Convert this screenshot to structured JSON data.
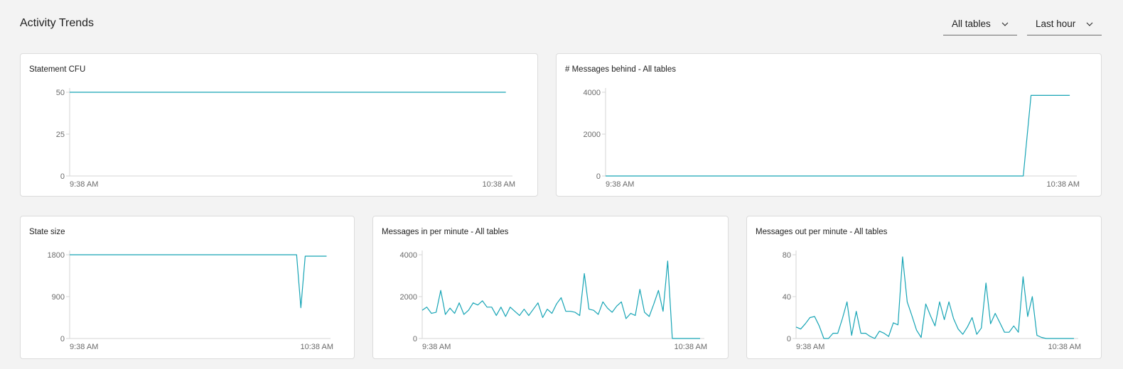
{
  "header": {
    "title": "Activity Trends",
    "filter_tables": "All tables",
    "filter_range": "Last hour"
  },
  "colors": {
    "line": "#16a4b5",
    "axis": "#d6d6d6",
    "tick_text": "#6b6b6b"
  },
  "cards": [
    {
      "id": "statement-cfu",
      "title": "Statement CFU"
    },
    {
      "id": "messages-behind",
      "title": "# Messages behind - All tables"
    },
    {
      "id": "state-size",
      "title": "State size"
    },
    {
      "id": "messages-in",
      "title": "Messages in per minute - All tables"
    },
    {
      "id": "messages-out",
      "title": "Messages out per minute - All tables"
    }
  ],
  "chart_data": [
    {
      "type": "line",
      "title": "Statement CFU",
      "x_tick_labels": [
        "9:38 AM",
        "10:38 AM"
      ],
      "y_ticks": [
        0,
        25,
        50
      ],
      "ylim": [
        0,
        50
      ],
      "series": [
        {
          "values": [
            50,
            50,
            50,
            50,
            50,
            50,
            50,
            50,
            50,
            50,
            50,
            50,
            50,
            50,
            50,
            50,
            50,
            50,
            50,
            50,
            50,
            50,
            50,
            50,
            50,
            50,
            50,
            50,
            50,
            50,
            50,
            50,
            50,
            50,
            50,
            50,
            50,
            50,
            50,
            50,
            50,
            50,
            50,
            50,
            50,
            50,
            50,
            50,
            50,
            50,
            50,
            50,
            50,
            50,
            50,
            50,
            50,
            50,
            50,
            50
          ]
        }
      ],
      "x_count": 61
    },
    {
      "type": "line",
      "title": "# Messages behind - All tables",
      "x_tick_labels": [
        "9:38 AM",
        "10:38 AM"
      ],
      "y_ticks": [
        0,
        2000,
        4000
      ],
      "ylim": [
        0,
        4000
      ],
      "series": [
        {
          "values": [
            0,
            0,
            0,
            0,
            0,
            0,
            0,
            0,
            0,
            0,
            0,
            0,
            0,
            0,
            0,
            0,
            0,
            0,
            0,
            0,
            0,
            0,
            0,
            0,
            0,
            0,
            0,
            0,
            0,
            0,
            0,
            0,
            0,
            0,
            0,
            0,
            0,
            0,
            0,
            0,
            0,
            0,
            0,
            0,
            0,
            0,
            0,
            0,
            0,
            0,
            0,
            0,
            0,
            0,
            0,
            3850,
            3850,
            3850,
            3850,
            3850,
            3850
          ]
        }
      ],
      "x_count": 61
    },
    {
      "type": "line",
      "title": "State size",
      "x_tick_labels": [
        "9:38 AM",
        "10:38 AM"
      ],
      "y_ticks": [
        0,
        900,
        1800
      ],
      "ylim": [
        0,
        1800
      ],
      "series": [
        {
          "values": [
            1800,
            1800,
            1800,
            1800,
            1800,
            1800,
            1800,
            1800,
            1800,
            1800,
            1800,
            1800,
            1800,
            1800,
            1800,
            1800,
            1800,
            1800,
            1800,
            1800,
            1800,
            1800,
            1800,
            1800,
            1800,
            1800,
            1800,
            1800,
            1800,
            1800,
            1800,
            1800,
            1800,
            1800,
            1800,
            1800,
            1800,
            1800,
            1800,
            1800,
            1800,
            1800,
            1800,
            1800,
            1800,
            1800,
            1800,
            1800,
            1800,
            1800,
            1800,
            1800,
            1800,
            1800,
            660,
            1770,
            1770,
            1770,
            1770,
            1770,
            1770
          ]
        }
      ],
      "x_count": 61
    },
    {
      "type": "line",
      "title": "Messages in per minute - All tables",
      "x_tick_labels": [
        "9:38 AM",
        "10:38 AM"
      ],
      "y_ticks": [
        0,
        2000,
        4000
      ],
      "ylim": [
        0,
        4000
      ],
      "series": [
        {
          "values": [
            1350,
            1500,
            1200,
            1250,
            2300,
            1150,
            1450,
            1200,
            1700,
            1150,
            1350,
            1700,
            1600,
            1800,
            1500,
            1500,
            1100,
            1500,
            1050,
            1500,
            1300,
            1100,
            1400,
            1100,
            1400,
            1700,
            1000,
            1400,
            1200,
            1650,
            1950,
            1300,
            1300,
            1250,
            1100,
            3100,
            1400,
            1350,
            1150,
            1750,
            1450,
            1250,
            1550,
            1750,
            950,
            1200,
            1100,
            2350,
            1250,
            1050,
            1650,
            2300,
            1300,
            3700,
            0,
            0,
            0,
            0,
            0,
            0,
            0
          ]
        }
      ],
      "x_count": 61
    },
    {
      "type": "line",
      "title": "Messages out per minute - All tables",
      "x_tick_labels": [
        "9:38 AM",
        "10:38 AM"
      ],
      "y_ticks": [
        0,
        40,
        80
      ],
      "ylim": [
        0,
        80
      ],
      "series": [
        {
          "values": [
            11,
            9,
            14,
            20,
            21,
            12,
            0,
            0,
            5,
            5,
            19,
            35,
            3,
            26,
            5,
            5,
            2,
            0,
            7,
            5,
            2,
            15,
            13,
            78,
            35,
            22,
            8,
            1,
            33,
            22,
            12,
            35,
            18,
            35,
            19,
            9,
            4,
            11,
            20,
            4,
            10,
            53,
            14,
            24,
            15,
            6,
            6,
            12,
            6,
            59,
            21,
            40,
            3,
            1,
            0,
            0,
            0,
            0,
            0,
            0,
            0
          ]
        }
      ],
      "x_count": 61
    }
  ]
}
